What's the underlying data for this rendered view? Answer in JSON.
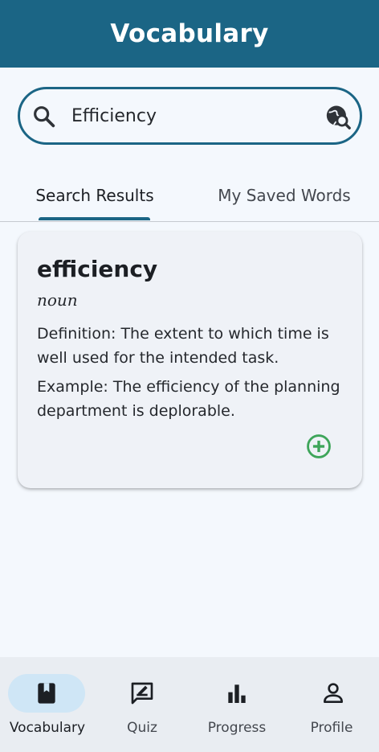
{
  "appbar": {
    "title": "Vocabulary"
  },
  "search": {
    "value": "Efficiency",
    "placeholder": ""
  },
  "tabs": [
    {
      "label": "Search Results",
      "selected": true
    },
    {
      "label": "My Saved Words",
      "selected": false
    }
  ],
  "result": {
    "word": "efficiency",
    "part_of_speech": "noun",
    "definition": "Definition: The extent to which time is well used for the intended task.",
    "example": "Example: The efficiency of the planning department is deplorable."
  },
  "bottom_nav": {
    "items": [
      {
        "label": "Vocabulary",
        "icon": "book-icon",
        "selected": true
      },
      {
        "label": "Quiz",
        "icon": "quiz-icon",
        "selected": false
      },
      {
        "label": "Progress",
        "icon": "bar-chart-icon",
        "selected": false
      },
      {
        "label": "Profile",
        "icon": "person-icon",
        "selected": false
      }
    ]
  },
  "colors": {
    "primary": "#1b6585",
    "background": "#f4f8fd",
    "card": "#eff2f7",
    "add_green": "#3ea55a",
    "nav_selected": "#cfe6f6"
  }
}
